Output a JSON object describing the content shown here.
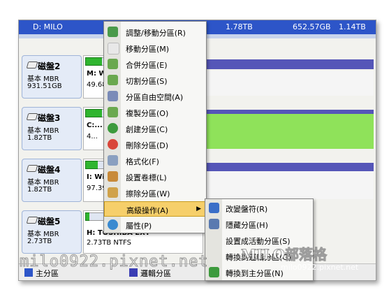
{
  "top_row": {
    "drive": "D: MILO",
    "capacity": "1.78TB",
    "used": "652.57GB",
    "free": "1.14TB"
  },
  "disks": [
    {
      "name": "磁盤2",
      "type": "基本 MBR",
      "size": "931.51GB",
      "partition": "M: W...",
      "partition_size": "49.68..."
    },
    {
      "name": "磁盤3",
      "type": "基本 MBR",
      "size": "1.82TB",
      "partition": "C:...",
      "partition_size": "4..."
    },
    {
      "name": "磁盤4",
      "type": "基本 MBR",
      "size": "1.82TB",
      "partition": "I: Wi...",
      "partition_size": "97.39..."
    },
    {
      "name": "磁盤5",
      "type": "基本 MBR",
      "size": "2.73TB",
      "partition": "H: TOSHIBA EXT",
      "partition_size": "2.73TB NTFS"
    }
  ],
  "menu": {
    "items": [
      {
        "label": "調整/移動分區(R)",
        "icon": "resize-icon"
      },
      {
        "label": "移動分區(M)",
        "icon": "move-icon"
      },
      {
        "label": "合併分區(E)",
        "icon": "merge-icon"
      },
      {
        "label": "切割分區(S)",
        "icon": "split-icon"
      },
      {
        "label": "分區自由空間(A)",
        "icon": "free-space-icon"
      },
      {
        "label": "複製分區(O)",
        "icon": "copy-icon"
      },
      {
        "label": "創建分區(C)",
        "icon": "create-icon"
      },
      {
        "label": "刪除分區(D)",
        "icon": "delete-icon"
      },
      {
        "label": "格式化(F)",
        "icon": "format-icon"
      },
      {
        "label": "設置卷標(L)",
        "icon": "label-icon"
      },
      {
        "label": "擦除分區(W)",
        "icon": "wipe-icon"
      },
      {
        "label": "高級操作(A)",
        "icon": "advanced-icon",
        "submenu_arrow": "▶"
      },
      {
        "label": "屬性(P)",
        "icon": "properties-icon"
      }
    ]
  },
  "submenu": {
    "items": [
      {
        "label": "改變盤符(R)",
        "icon": "drive-letter-icon"
      },
      {
        "label": "隱藏分區(H)",
        "icon": "hide-icon"
      },
      {
        "label": "設置成活動分區(S)",
        "icon": "active-icon"
      },
      {
        "label": "轉換到邏輯分區(G)",
        "icon": "convert-logical-icon"
      },
      {
        "label": "轉換到主分區(N)",
        "icon": "convert-primary-icon"
      }
    ]
  },
  "legend": {
    "primary": "主分區",
    "logical": "邏輯分區"
  },
  "watermark": {
    "left": "milo0922.pixnet.net",
    "right": "MILO部落格",
    "url": "milo0922.pixnet.net"
  },
  "colors": {
    "header_blue": "#2d55c8",
    "partition_green": "#8fe25a",
    "menu_highlight": "#f6cf6a",
    "strip_purple": "#3b3eb4"
  }
}
